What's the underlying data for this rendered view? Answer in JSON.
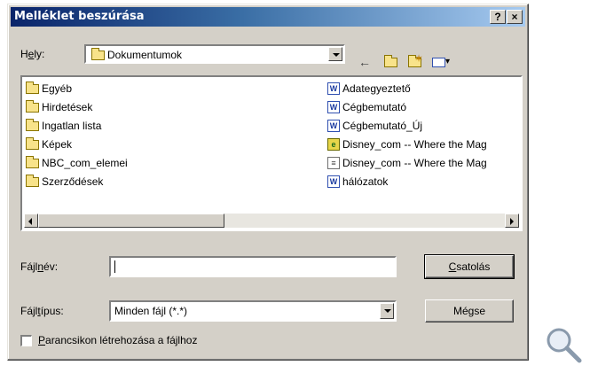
{
  "dialog": {
    "title": "Melléklet beszúrása",
    "help_label": "?",
    "close_label": "×"
  },
  "location": {
    "label_pre": "H",
    "label_u": "e",
    "label_post": "ly:",
    "value": "Dokumentumok"
  },
  "toolbar": {
    "back_glyph": "←",
    "up_glyph": "⇧",
    "newfolder_glyph": "✶",
    "views_glyph": "▾"
  },
  "files": {
    "left": [
      {
        "name": "Egyéb",
        "type": "folder"
      },
      {
        "name": "Hirdetések",
        "type": "folder"
      },
      {
        "name": "Ingatlan lista",
        "type": "folder"
      },
      {
        "name": "Képek",
        "type": "folder"
      },
      {
        "name": "NBC_com_elemei",
        "type": "folder"
      },
      {
        "name": "Szerződések",
        "type": "folder"
      }
    ],
    "right": [
      {
        "name": "Adategyeztető",
        "type": "word"
      },
      {
        "name": "Cégbemutató",
        "type": "word"
      },
      {
        "name": "Cégbemutató_Új",
        "type": "word"
      },
      {
        "name": "Disney_com -- Where the Mag",
        "type": "web"
      },
      {
        "name": "Disney_com -- Where the Mag",
        "type": "plain"
      },
      {
        "name": "hálózatok",
        "type": "word"
      }
    ]
  },
  "filename": {
    "label_pre": "Fájl",
    "label_u": "n",
    "label_post": "év:",
    "value": ""
  },
  "filetype": {
    "label_pre": "Fájl",
    "label_u": "t",
    "label_post": "ípus:",
    "value": "Minden fájl (*.*)"
  },
  "buttons": {
    "attach_u": "C",
    "attach_rest": "satolás",
    "cancel": "Mégse"
  },
  "shortcut": {
    "label_u": "P",
    "label_rest": "arancsikon létrehozása a fájlhoz",
    "checked": false
  }
}
